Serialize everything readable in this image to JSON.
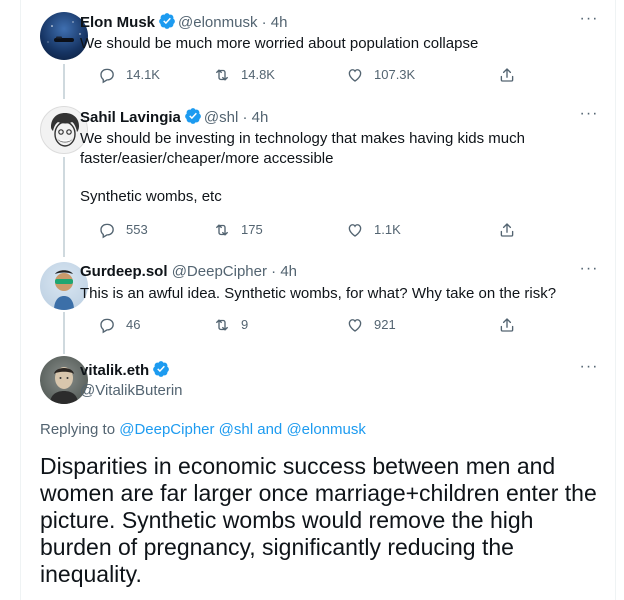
{
  "tweets": [
    {
      "name": "Elon Musk",
      "handle": "@elonmusk",
      "time": "· 4h",
      "verified": true,
      "text": [
        "We should be much more worried about population collapse"
      ],
      "replies": "14.1K",
      "retweets": "14.8K",
      "likes": "107.3K"
    },
    {
      "name": "Sahil Lavingia",
      "handle": "@shl",
      "time": "· 4h",
      "verified": true,
      "text": [
        "We should be investing in technology that makes having kids much",
        "faster/easier/cheaper/more accessible",
        "",
        "Synthetic wombs, etc"
      ],
      "replies": "553",
      "retweets": "175",
      "likes": "1.1K"
    },
    {
      "name": "Gurdeep.sol",
      "handle": "@DeepCipher",
      "time": "· 4h",
      "verified": false,
      "text": [
        "This is an awful idea. Synthetic wombs, for what? Why take on the risk?"
      ],
      "replies": "46",
      "retweets": "9",
      "likes": "921"
    }
  ],
  "main": {
    "name": "vitalik.eth",
    "handle": "@VitalikButerin",
    "verified": true,
    "replying_label": "Replying to",
    "replying_mentions": [
      "@DeepCipher",
      "@shl",
      "and",
      "@elonmusk"
    ],
    "text": "Disparities in economic success between men and women are far larger once marriage+children enter the picture. Synthetic wombs would remove the high burden of pregnancy, significantly reducing the inequality."
  },
  "icons": {
    "reply": "speech-bubble-icon",
    "retweet": "retweet-icon",
    "like": "heart-icon",
    "share": "share-icon",
    "more": "more-dots-icon",
    "verified": "verified-badge-icon"
  },
  "colors": {
    "verified": "#1d9bf0",
    "link": "#1d9bf0",
    "secondary_text": "#536471",
    "thread_line": "#cfd9de"
  }
}
